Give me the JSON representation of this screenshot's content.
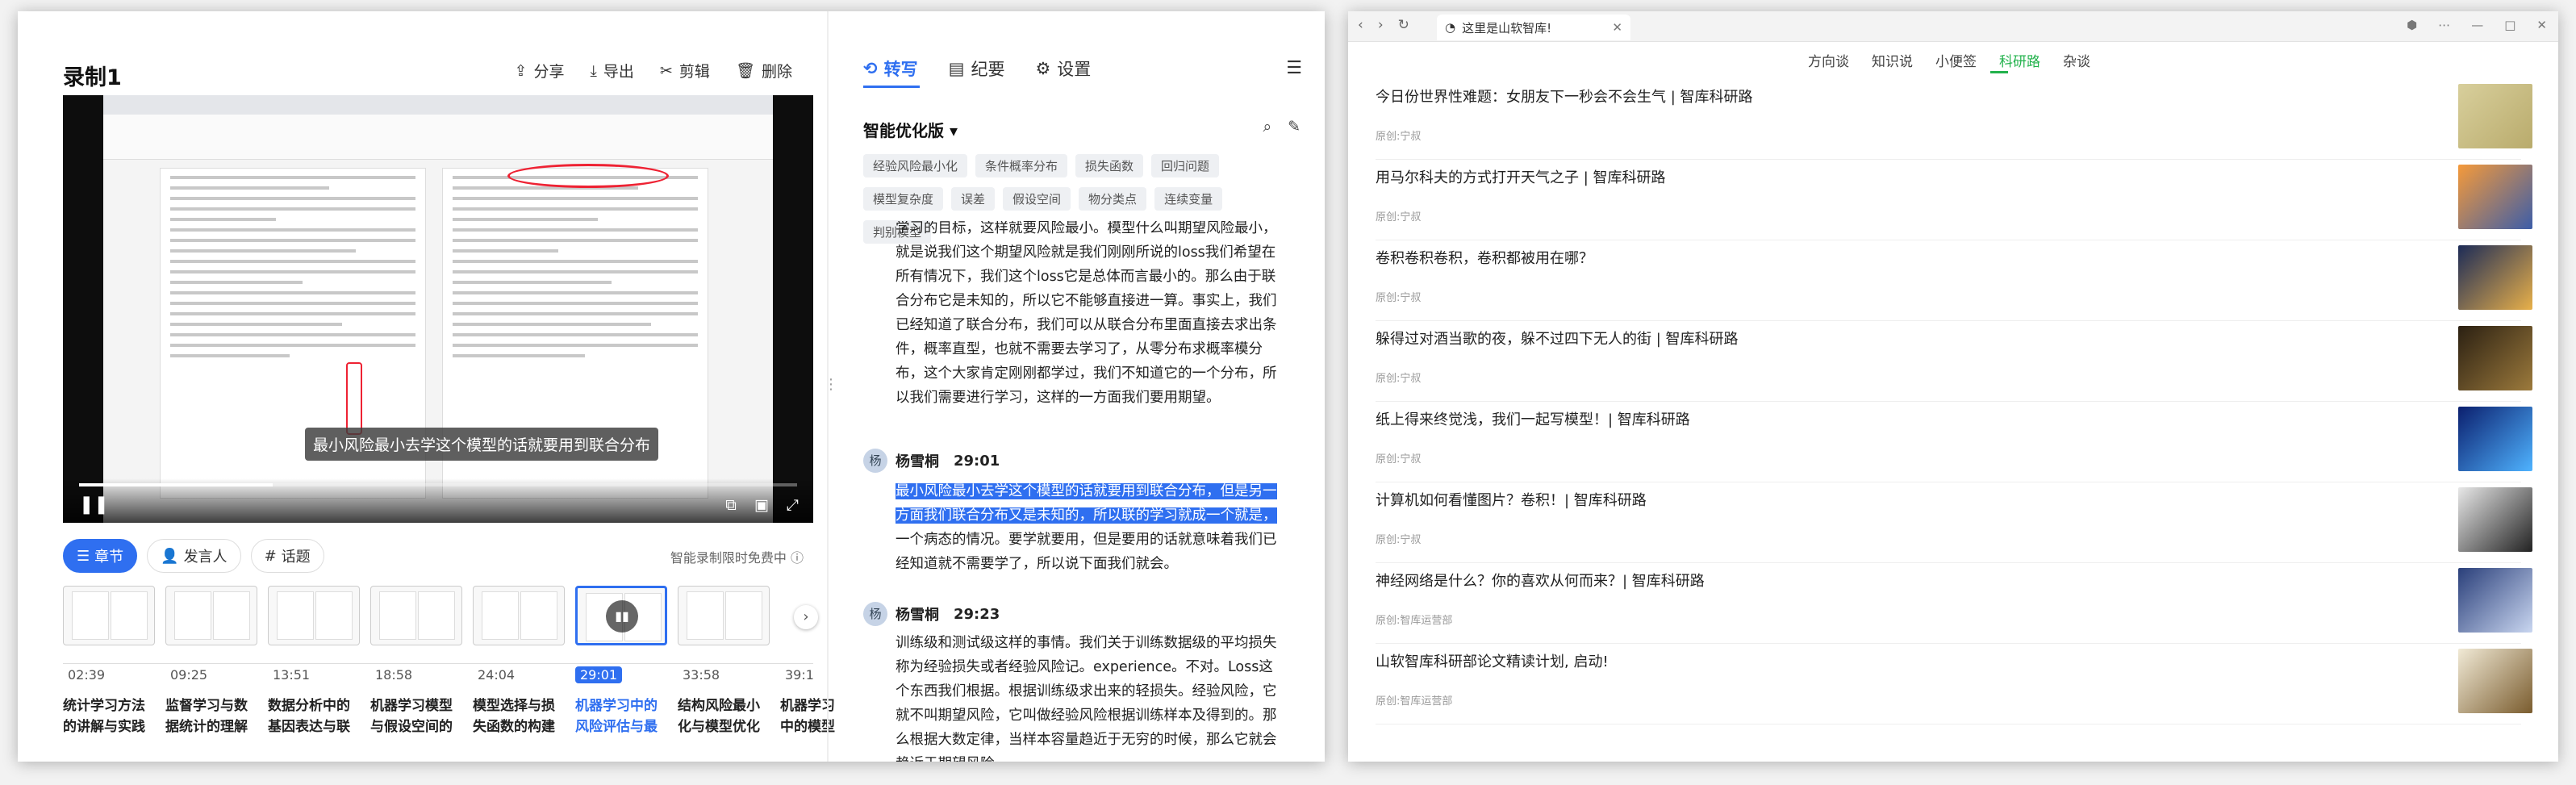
{
  "recorder": {
    "title": "录制1",
    "actions": [
      {
        "label": "分享",
        "icon": "share-icon",
        "glyph": "⇪"
      },
      {
        "label": "导出",
        "icon": "export-icon",
        "glyph": "⤓"
      },
      {
        "label": "剪辑",
        "icon": "scissors-icon",
        "glyph": "✂"
      },
      {
        "label": "删除",
        "icon": "trash-icon",
        "glyph": "🗑"
      }
    ],
    "video": {
      "subtitle": "最小风险最小去学这个模型的话就要用到联合分布",
      "progress": 0.27
    },
    "chapter_tabs": [
      {
        "label": "章节",
        "icon": "list-icon",
        "glyph": "☰",
        "active": true
      },
      {
        "label": "发言人",
        "icon": "person-icon",
        "glyph": "👤",
        "active": false
      },
      {
        "label": "话题",
        "icon": "hash-icon",
        "glyph": "#",
        "active": false
      }
    ],
    "free_note": "智能录制限时免费中",
    "chapters": [
      {
        "time": "02:39",
        "title": "统计学习方法的讲解与实践"
      },
      {
        "time": "09:25",
        "title": "监督学习与数据统计的理解"
      },
      {
        "time": "13:51",
        "title": "数据分析中的基因表达与联合"
      },
      {
        "time": "18:58",
        "title": "机器学习模型与假设空间的构建"
      },
      {
        "time": "24:04",
        "title": "模型选择与损失函数的构建"
      },
      {
        "time": "29:01",
        "title": "机器学习中的风险评估与最小化",
        "active": true
      },
      {
        "time": "33:58",
        "title": "结构风险最小化与模型优化策略"
      },
      {
        "time": "39:1",
        "title": "机器学习中的模型"
      }
    ]
  },
  "notes_panel": {
    "tabs": [
      {
        "label": "转写",
        "icon": "transcribe-icon",
        "glyph": "⟲",
        "active": true
      },
      {
        "label": "纪要",
        "icon": "document-icon",
        "glyph": "▤",
        "active": false
      },
      {
        "label": "设置",
        "icon": "gear-icon",
        "glyph": "⚙",
        "active": false
      }
    ],
    "summary_heading": "智能优化版",
    "keywords": [
      "经验风险最小化",
      "条件概率分布",
      "损失函数",
      "回归问题",
      "模型复杂度",
      "误差",
      "假设空间",
      "物分类点",
      "连续变量",
      "判别模型"
    ],
    "transcript": [
      {
        "speaker": "",
        "time": "",
        "text": "学习的目标，这样就要风险最小。模型什么叫期望风险最小，就是说我们这个期望风险就是我们刚刚所说的loss我们希望在所有情况下，我们这个loss它是总体而言最小的。那么由于联合分布它是未知的，所以它不能够直接进一算。事实上，我们已经知道了联合分布，我们可以从联合分布里面直接去求出条件，概率直型，也就不需要去学习了，从零分布求概率模分布，这个大家肯定刚刚都学过，我们不知道它的一个分布，所以我们需要进行学习，这样的一方面我们要用期望。"
      },
      {
        "speaker": "杨雪桐",
        "time": "29:01",
        "highlight": "最小风险最小去学这个模型的话就要用到联合分布，但是另一方面我们联合分布又是未知的，所以联的学习就成一个就是，",
        "text": "一个病态的情况。要学就要用，但是要用的话就意味着我们已经知道就不需要学了，所以说下面我们就会。"
      },
      {
        "speaker": "杨雪桐",
        "time": "29:23",
        "text": "训练级和测试级这样的事情。我们关于训练数据级的平均损失称为经验损失或者经验风险记。experience。不对。Loss这个东西我们根据。根据训练级求出来的轻损失。经验风险，它就不叫期望风险，它叫做经验风险根据训练样本及得到的。那么根据大数定律，当样本容量趋近于无穷的时候，那么它就会趋近于期望风险。"
      }
    ]
  },
  "browser": {
    "tab_title": "这里是山软智库!",
    "nav_tabs": [
      "方向谈",
      "知识说",
      "小便签",
      "科研路",
      "杂谈"
    ],
    "active_nav": "科研路",
    "articles": [
      {
        "title": "今日份世界性难题：女朋友下一秒会不会生气 | 智库科研路",
        "author": "原创:宁叔",
        "thumb_colors": [
          "#d8cf9c",
          "#b9ab6c"
        ]
      },
      {
        "title": "用马尔科夫的方式打开天气之子 | 智库科研路",
        "author": "原创:宁叔",
        "thumb_colors": [
          "#f59a3a",
          "#3c5da8"
        ]
      },
      {
        "title": "卷积卷积卷积，卷积都被用在哪？",
        "author": "原创:宁叔",
        "thumb_colors": [
          "#1c2b57",
          "#e8b04a"
        ]
      },
      {
        "title": "躲得过对酒当歌的夜，躲不过四下无人的街 | 智库科研路",
        "author": "原创:宁叔",
        "thumb_colors": [
          "#2b2012",
          "#9c7a3c"
        ]
      },
      {
        "title": "纸上得来终觉浅，我们一起写模型！| 智库科研路",
        "author": "原创:宁叔",
        "thumb_colors": [
          "#0b1f6e",
          "#4fb3ff"
        ]
      },
      {
        "title": "计算机如何看懂图片？卷积！| 智库科研路",
        "author": "原创:宁叔",
        "thumb_colors": [
          "#e8e8e8",
          "#222222"
        ]
      },
      {
        "title": "神经网络是什么？你的喜欢从何而来？| 智库科研路",
        "author": "原创:智库运营部",
        "thumb_colors": [
          "#2a3f7a",
          "#c9d6f0"
        ]
      },
      {
        "title": "山软智库科研部论文精读计划, 启动!",
        "author": "原创:智库运营部",
        "thumb_colors": [
          "#f1ead6",
          "#7a5c2e"
        ]
      }
    ]
  }
}
